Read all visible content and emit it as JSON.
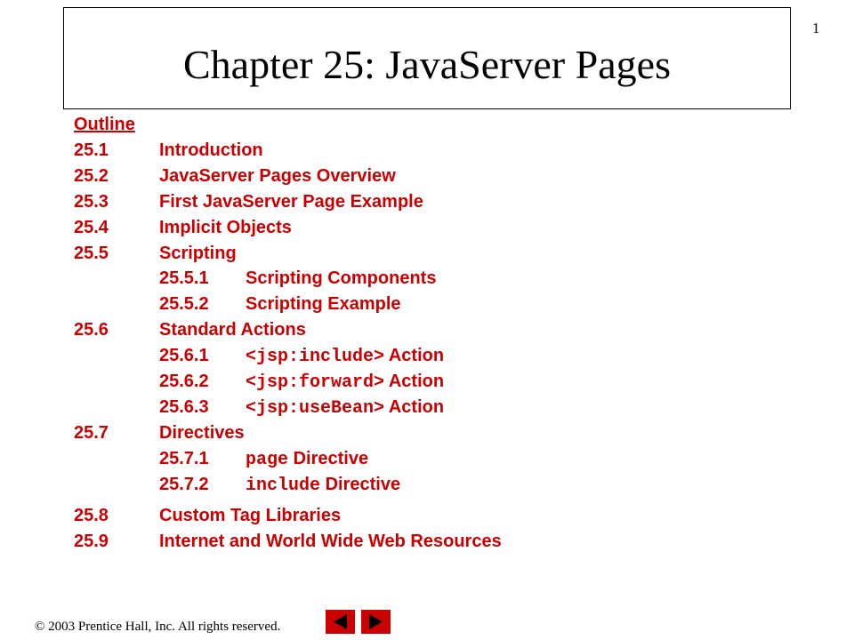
{
  "slide": {
    "number": "1",
    "title": "Chapter 25: JavaServer Pages"
  },
  "outline": {
    "heading": "Outline",
    "items": [
      {
        "num": "25.1",
        "label": "Introduction"
      },
      {
        "num": "25.2",
        "label": "JavaServer Pages Overview"
      },
      {
        "num": "25.3",
        "label": "First JavaServer Page Example"
      },
      {
        "num": "25.4",
        "label": "Implicit Objects"
      },
      {
        "num": "25.5",
        "label": "Scripting"
      },
      {
        "num": "25.5.1",
        "label": "Scripting Components"
      },
      {
        "num": "25.5.2",
        "label": "Scripting Example"
      },
      {
        "num": "25.6",
        "label": "Standard Actions"
      },
      {
        "num": "25.6.1",
        "code": "<jsp:include>",
        "label": " Action"
      },
      {
        "num": "25.6.2",
        "code": "<jsp:forward>",
        "label": " Action"
      },
      {
        "num": "25.6.3",
        "code": "<jsp:useBean>",
        "label": " Action"
      },
      {
        "num": "25.7",
        "label": "Directives"
      },
      {
        "num": "25.7.1",
        "code": "page",
        "label": " Directive"
      },
      {
        "num": "25.7.2",
        "code": "include",
        "label": " Directive"
      },
      {
        "num": "25.8",
        "label": "Custom Tag Libraries"
      },
      {
        "num": "25.9",
        "label": "Internet and World Wide Web Resources"
      }
    ]
  },
  "footer": {
    "copyright": "© 2003 Prentice Hall, Inc.  All rights reserved."
  },
  "nav": {
    "prev_icon": "triangle-left-icon",
    "next_icon": "triangle-right-icon",
    "button_color": "#cc0000"
  },
  "colors": {
    "outline_text": "#cc0000"
  }
}
